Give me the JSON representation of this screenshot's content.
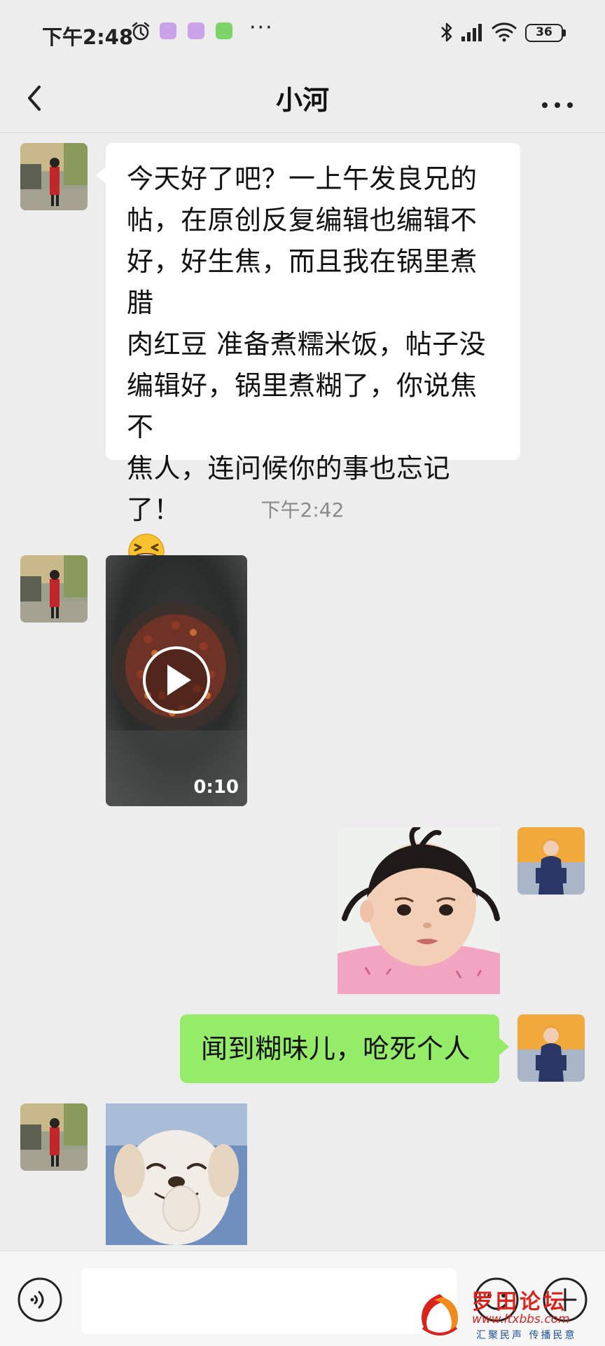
{
  "status_bar": {
    "time": "下午2:48",
    "battery": "36",
    "more": "···"
  },
  "header": {
    "title": "小河"
  },
  "messages": [
    {
      "from": "contact",
      "type": "text",
      "text_lines": [
        "今天好了吧？一上午发良兄的",
        "帖，在原创反复编辑也编辑不",
        "好，好生焦，而且我在锅里煮腊",
        "肉红豆 准备煮糯米饭，帖子没",
        "编辑好，锅里煮糊了，你说焦不",
        "焦人，连问候你的事也忘记了！"
      ],
      "emoji": "tired-laughing-face"
    },
    {
      "type": "time",
      "text": "下午2:42"
    },
    {
      "from": "contact",
      "type": "video",
      "duration": "0:10"
    },
    {
      "from": "me",
      "type": "sticker",
      "sticker": "girl-pigtails-sticker"
    },
    {
      "from": "me",
      "type": "text",
      "text": "闻到糊味儿，呛死个人"
    },
    {
      "from": "contact",
      "type": "sticker",
      "sticker": "laughing-puppy-sticker"
    }
  ],
  "input_bar": {
    "placeholder": "",
    "icons": [
      "voice-icon",
      "emoji-icon",
      "plus-icon"
    ]
  },
  "watermark": {
    "title": "罗田论坛",
    "url": "www.ltxbbs.com",
    "slogan": "汇聚民声 传播民意"
  },
  "colors": {
    "background": "#ededed",
    "outgoing_bubble": "#95ec69",
    "incoming_bubble": "#ffffff",
    "watermark_red": "#d9231d",
    "watermark_blue": "#1c4f9c"
  }
}
